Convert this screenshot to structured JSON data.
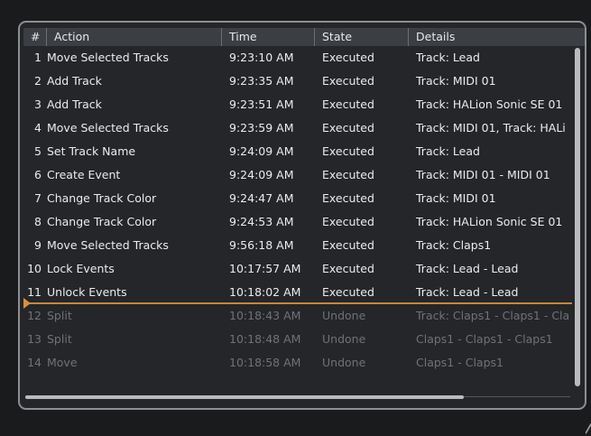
{
  "header": {
    "num": "#",
    "action": "Action",
    "time": "Time",
    "state": "State",
    "details": "Details"
  },
  "rows": [
    {
      "num": "1",
      "action": "Move Selected Tracks",
      "time": "9:23:10 AM",
      "state": "Executed",
      "details": "Track: Lead"
    },
    {
      "num": "2",
      "action": "Add Track",
      "time": "9:23:35 AM",
      "state": "Executed",
      "details": "Track: MIDI 01"
    },
    {
      "num": "3",
      "action": "Add Track",
      "time": "9:23:51 AM",
      "state": "Executed",
      "details": "Track: HALion Sonic SE 01"
    },
    {
      "num": "4",
      "action": "Move Selected Tracks",
      "time": "9:23:59 AM",
      "state": "Executed",
      "details": "Track: MIDI 01, Track: HALi"
    },
    {
      "num": "5",
      "action": "Set Track Name",
      "time": "9:24:09 AM",
      "state": "Executed",
      "details": "Track: Lead"
    },
    {
      "num": "6",
      "action": "Create Event",
      "time": "9:24:09 AM",
      "state": "Executed",
      "details": "Track: MIDI 01 - MIDI 01"
    },
    {
      "num": "7",
      "action": "Change Track Color",
      "time": "9:24:47 AM",
      "state": "Executed",
      "details": "Track: MIDI 01"
    },
    {
      "num": "8",
      "action": "Change Track Color",
      "time": "9:24:53 AM",
      "state": "Executed",
      "details": "Track: HALion Sonic SE 01"
    },
    {
      "num": "9",
      "action": "Move Selected Tracks",
      "time": "9:56:18 AM",
      "state": "Executed",
      "details": "Track: Claps1"
    },
    {
      "num": "10",
      "action": "Lock Events",
      "time": "10:17:57 AM",
      "state": "Executed",
      "details": "Track: Lead - Lead"
    },
    {
      "num": "11",
      "action": "Unlock Events",
      "time": "10:18:02 AM",
      "state": "Executed",
      "details": "Track: Lead - Lead"
    },
    {
      "num": "12",
      "action": "Split",
      "time": "10:18:43 AM",
      "state": "Undone",
      "details": "Track: Claps1 - Claps1 - Cla"
    },
    {
      "num": "13",
      "action": "Split",
      "time": "10:18:48 AM",
      "state": "Undone",
      "details": "Claps1 - Claps1 - Claps1"
    },
    {
      "num": "14",
      "action": "Move",
      "time": "10:18:58 AM",
      "state": "Undone",
      "details": "Claps1 - Claps1"
    }
  ],
  "colors": {
    "executed_text": "#ececec",
    "undone_text": "#6f7276",
    "undo_marker": "#c9873a",
    "header_bg": "#3b3e42",
    "panel_bg": "#242629"
  }
}
